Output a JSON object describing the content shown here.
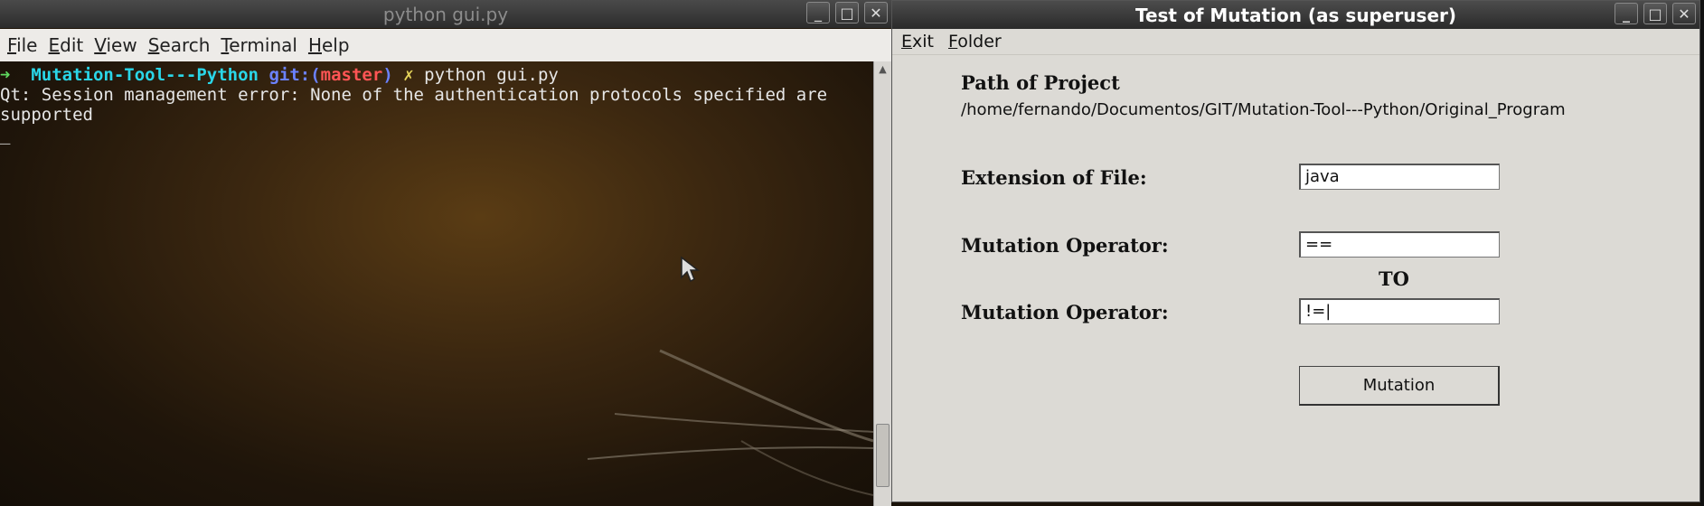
{
  "terminal": {
    "title": "python gui.py",
    "menu": [
      "File",
      "Edit",
      "View",
      "Search",
      "Terminal",
      "Help"
    ],
    "prompt": {
      "arrow": "➜",
      "dir": "Mutation-Tool---Python",
      "git_label": "git:(",
      "branch": "master",
      "git_close": ")",
      "dirty": "✗",
      "command": "python gui.py"
    },
    "output_line1": "Qt: Session management error: None of the authentication protocols specified are",
    "output_line2": "supported",
    "cursor": "_"
  },
  "app": {
    "title": "Test of Mutation (as superuser)",
    "menu": [
      "Exit",
      "Folder"
    ],
    "path_label": "Path of Project",
    "path_value": "/home/fernando/Documentos/GIT/Mutation-Tool---Python/Original_Program",
    "extension_label": "Extension of File:",
    "extension_value": "java",
    "operator_from_label": "Mutation Operator:",
    "operator_from_value": "==",
    "to_label": "TO",
    "operator_to_label": "Mutation Operator:",
    "operator_to_value": "!=|",
    "mutation_button": "Mutation"
  },
  "window_buttons": {
    "minimize": "_",
    "maximize": "□",
    "close": "✕"
  }
}
